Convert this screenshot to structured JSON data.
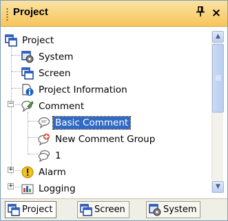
{
  "panel": {
    "title": "Project",
    "pin_glyph": "ԉ",
    "close_glyph": "×"
  },
  "tree": {
    "items": [
      {
        "label": "Project",
        "icon": "project-icon"
      },
      {
        "label": "System",
        "icon": "system-icon"
      },
      {
        "label": "Screen",
        "icon": "screen-icon"
      },
      {
        "label": "Project Information",
        "icon": "project-information-icon"
      },
      {
        "label": "Comment",
        "icon": "comment-icon"
      },
      {
        "label": "Basic Comment",
        "icon": "basic-comment-icon",
        "selected": true
      },
      {
        "label": "New Comment Group",
        "icon": "new-comment-group-icon"
      },
      {
        "label": "1",
        "icon": "comment-group-icon"
      },
      {
        "label": "Alarm",
        "icon": "alarm-icon"
      },
      {
        "label": "Logging",
        "icon": "logging-icon"
      }
    ],
    "expanders": {
      "comment": "−",
      "alarm": "+",
      "logging": "+"
    }
  },
  "scrollbar": {
    "up": "▲",
    "down": "▼"
  },
  "tabs": [
    {
      "label": "Project",
      "icon": "project-icon",
      "active": true
    },
    {
      "label": "Screen",
      "icon": "screen-icon"
    },
    {
      "label": "System",
      "icon": "system-icon"
    }
  ]
}
